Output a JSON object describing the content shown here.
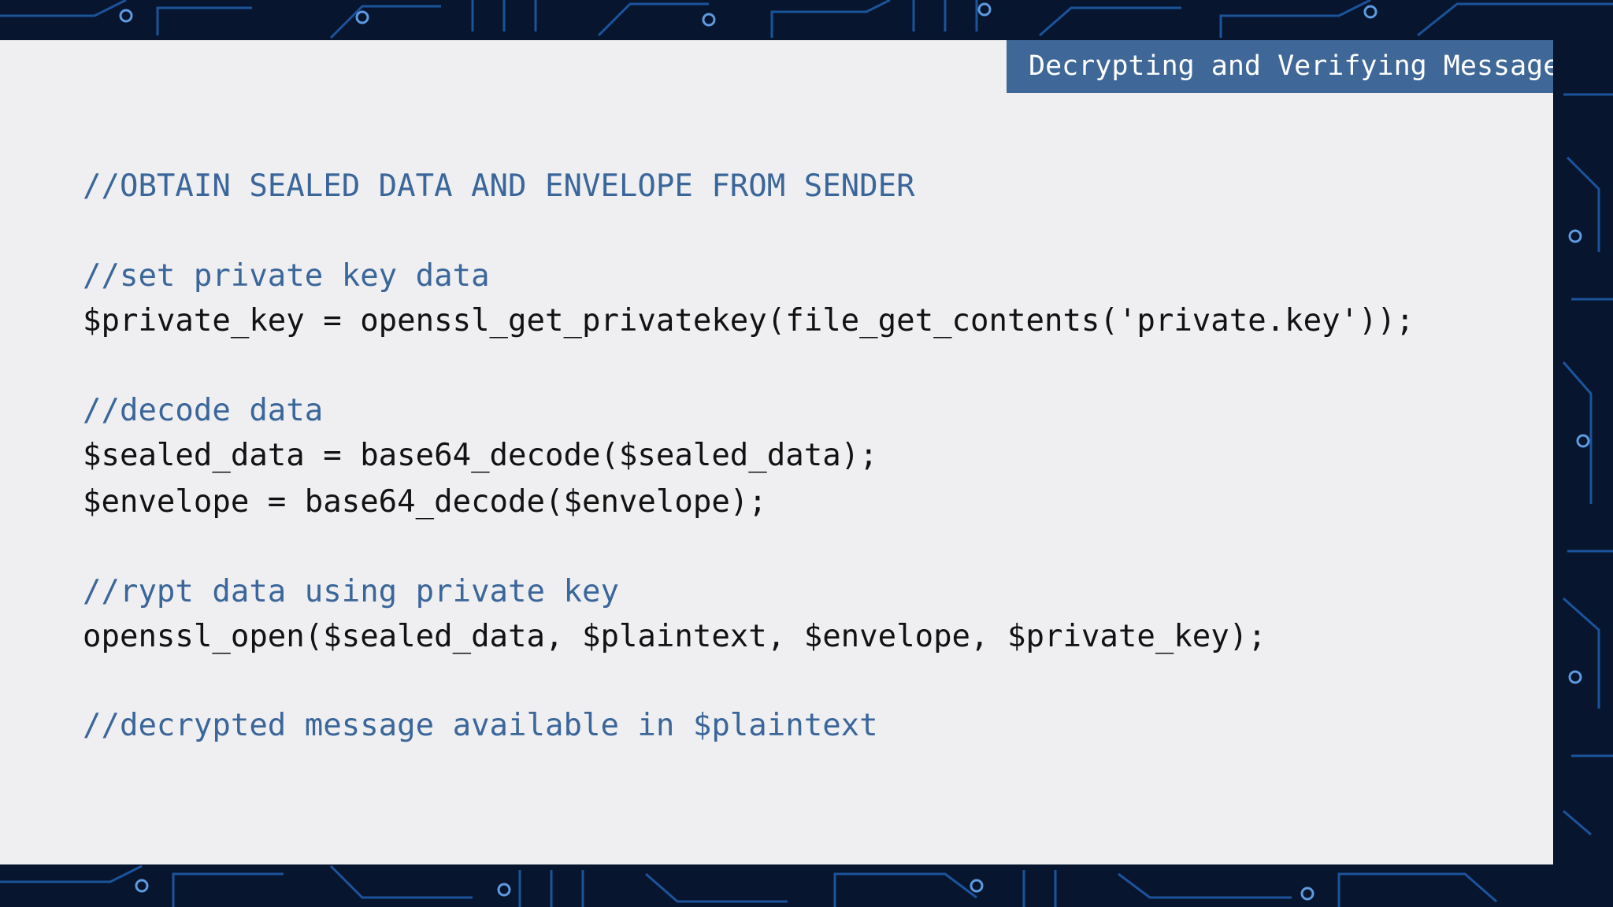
{
  "slide": {
    "title": "Decrypting and Verifying Message",
    "lines": [
      {
        "kind": "comment",
        "text": "//OBTAIN SEALED DATA AND ENVELOPE FROM SENDER"
      },
      {
        "kind": "comment",
        "text": "//set private key data"
      },
      {
        "kind": "code",
        "text": "$private_key = openssl_get_privatekey(file_get_contents('private.key'));"
      },
      {
        "kind": "comment",
        "text": "//decode data"
      },
      {
        "kind": "code",
        "text": "$sealed_data = base64_decode($sealed_data);"
      },
      {
        "kind": "code",
        "text": "$envelope = base64_decode($envelope);"
      },
      {
        "kind": "comment",
        "text": "//rypt data using private key"
      },
      {
        "kind": "code",
        "text": "openssl_open($sealed_data, $plaintext, $envelope, $private_key);"
      },
      {
        "kind": "comment",
        "text": "//decrypted message available in $plaintext"
      }
    ]
  },
  "colors": {
    "comment": "#3b669a",
    "code": "#121212",
    "title_bar": "#3f6798",
    "panel": "#efeff1",
    "background": "#07152e"
  },
  "background_image": "circuit-board"
}
